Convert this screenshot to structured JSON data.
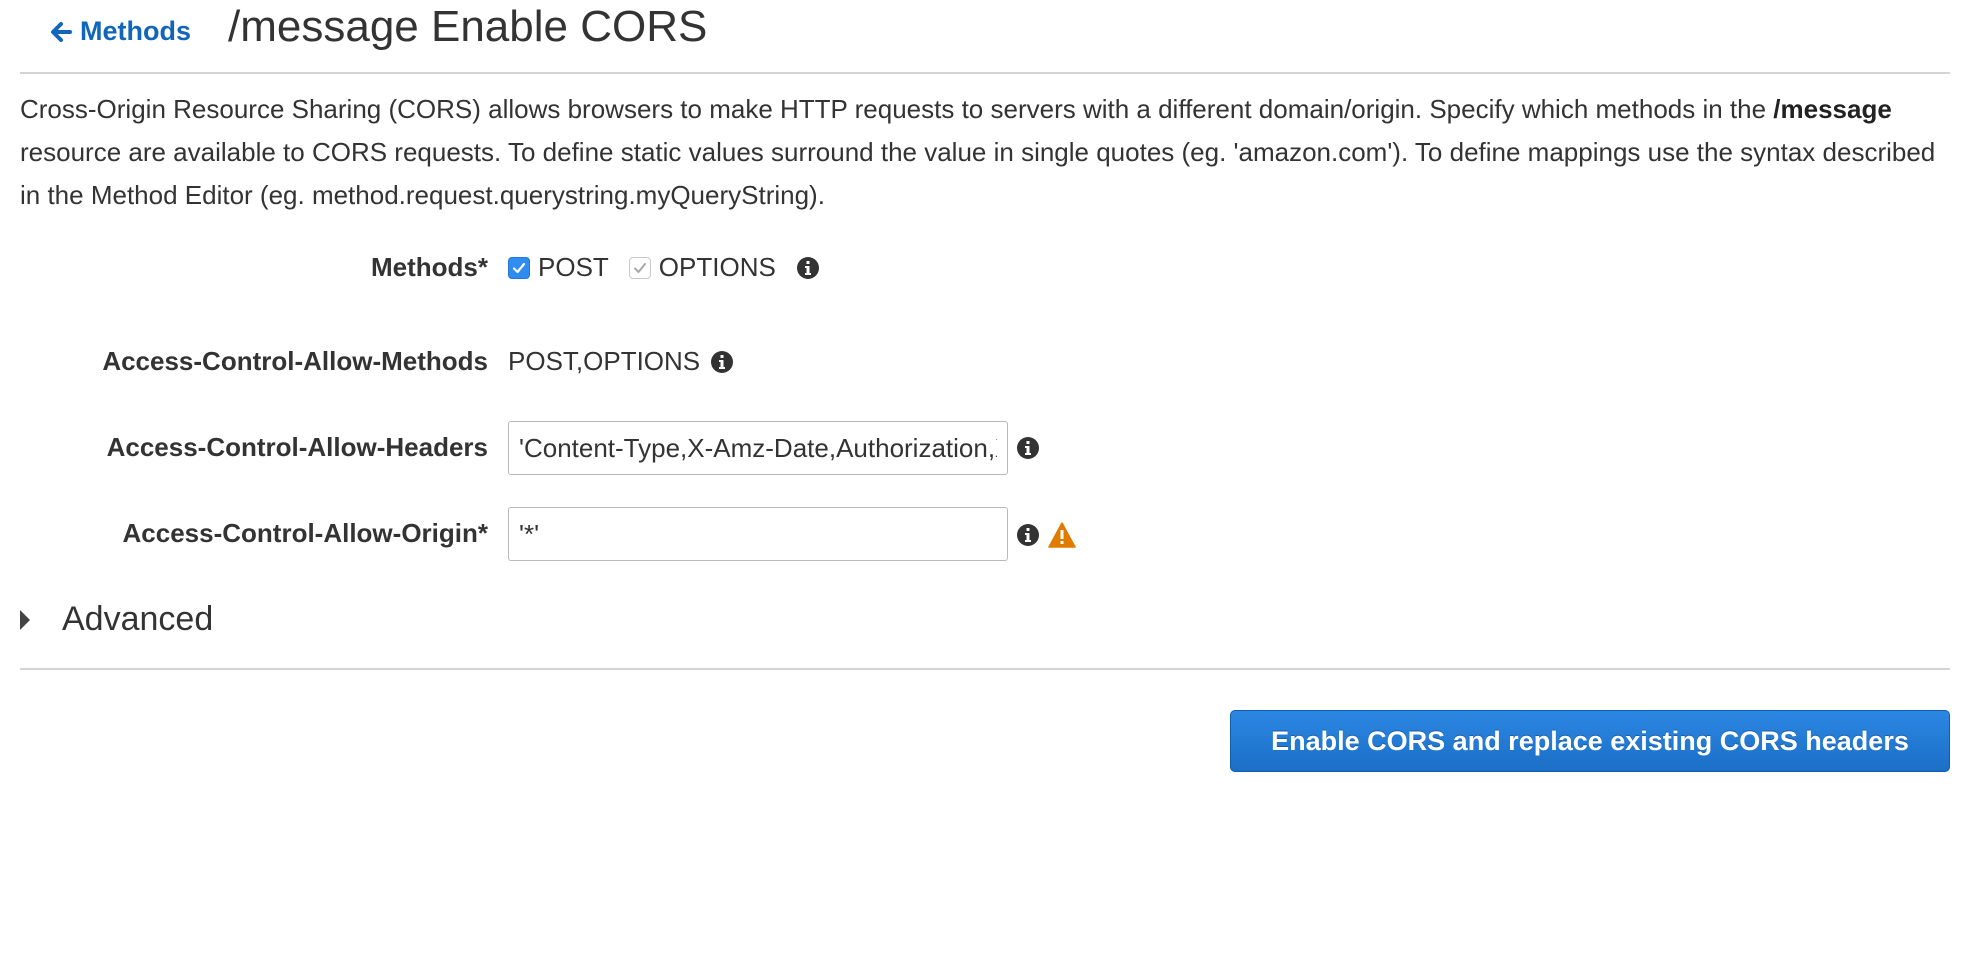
{
  "header": {
    "back_label": "Methods",
    "title": "/message Enable CORS"
  },
  "description": {
    "part1": "Cross-Origin Resource Sharing (CORS) allows browsers to make HTTP requests to servers with a different domain/origin. Specify which methods in the ",
    "resource": "/message",
    "part2": " resource are available to CORS requests. To define static values surround the value in single quotes (eg. 'amazon.com'). To define mappings use the syntax described in the Method Editor (eg. method.request.querystring.myQueryString)."
  },
  "form": {
    "methods_label": "Methods*",
    "methods": [
      {
        "label": "POST",
        "checked": true,
        "disabled": false
      },
      {
        "label": "OPTIONS",
        "checked": true,
        "disabled": true
      }
    ],
    "allow_methods_label": "Access-Control-Allow-Methods",
    "allow_methods_value": "POST,OPTIONS",
    "allow_headers_label": "Access-Control-Allow-Headers",
    "allow_headers_value": "'Content-Type,X-Amz-Date,Authorization,X-Api-Key,X-Amz-Security-Token'",
    "allow_origin_label": "Access-Control-Allow-Origin*",
    "allow_origin_value": "'*'"
  },
  "advanced": {
    "label": "Advanced"
  },
  "actions": {
    "enable_cors_label": "Enable CORS and replace existing CORS headers"
  },
  "colors": {
    "link": "#1166bb",
    "primary_button": "#1f74cc",
    "checkbox_checked": "#2f8cf0",
    "warning": "#e07b00"
  },
  "icons": [
    "arrow-left-icon",
    "info-icon",
    "warning-icon",
    "checkmark-icon",
    "caret-right-icon"
  ]
}
